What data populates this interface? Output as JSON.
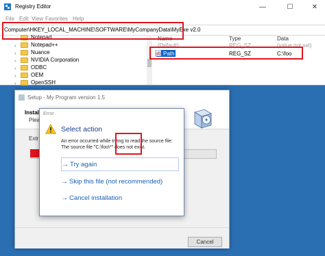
{
  "registry": {
    "title": "Registry Editor",
    "menu": [
      "File",
      "Edit",
      "View",
      "Favorites",
      "Help"
    ],
    "window_buttons": {
      "minimize": "—",
      "maximize": "☐",
      "close": "✕"
    },
    "address": "Computer\\HKEY_LOCAL_MACHINE\\SOFTWARE\\MyCompanyData\\MyExe v2.0",
    "tree_items": [
      "Notepad++",
      "Nuance",
      "NVIDIA Corporation",
      "ODBC",
      "OEM",
      "OpenSSH"
    ],
    "tree_partial_top": "Notepad",
    "columns": {
      "name": "Name",
      "type": "Type",
      "data": "Data"
    },
    "rows": [
      {
        "name": "(Default)",
        "type": "REG_SZ",
        "data": "(value not set)"
      },
      {
        "name": "Path",
        "type": "REG_SZ",
        "data": "C:\\foo"
      }
    ],
    "colors": {
      "highlight": "#e0141e",
      "selection": "#0a64c8"
    }
  },
  "setup": {
    "title": "Setup - My Program version 1.5",
    "install_label": "Install",
    "please_label": "Plea",
    "extracting_label": "Extr",
    "progress": 0.38,
    "cancel_label": "Cancel"
  },
  "error": {
    "title": "Error",
    "heading": "Select action",
    "message_line1": "An error occurred while trying to read the source file:",
    "message_line2": "The source file \"C:\\foo\\*\" does not exist.",
    "commands": [
      {
        "label": "Try again"
      },
      {
        "label": "Skip this file (not recommended)"
      },
      {
        "label": "Cancel installation"
      }
    ],
    "icon": "warning-icon"
  }
}
